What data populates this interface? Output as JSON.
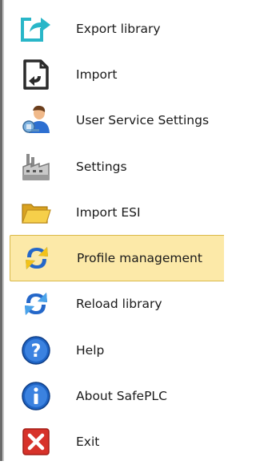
{
  "menu": {
    "items": [
      {
        "label": "Export library",
        "icon": "export-library-icon"
      },
      {
        "label": "Import",
        "icon": "import-icon"
      },
      {
        "label": "User Service Settings",
        "icon": "user-service-settings-icon"
      },
      {
        "label": "Settings",
        "icon": "settings-factory-icon"
      },
      {
        "label": "Import ESI",
        "icon": "folder-icon"
      },
      {
        "label": "Profile management",
        "icon": "refresh-arrows-icon",
        "selected": true
      },
      {
        "label": "Reload library",
        "icon": "refresh-arrows-icon"
      },
      {
        "label": "Help",
        "icon": "help-icon"
      },
      {
        "label": "About SafePLC",
        "icon": "info-icon"
      },
      {
        "label": "Exit",
        "icon": "exit-icon"
      }
    ]
  },
  "colors": {
    "selected_bg": "#fce9a8",
    "selected_border": "#d9b94a",
    "export_teal": "#29b6c8",
    "refresh_blue": "#2467c9",
    "refresh_yellow": "#f2c21a",
    "help_blue": "#1e63c4",
    "exit_red": "#d7322a",
    "folder_yellow": "#f3c53a"
  }
}
